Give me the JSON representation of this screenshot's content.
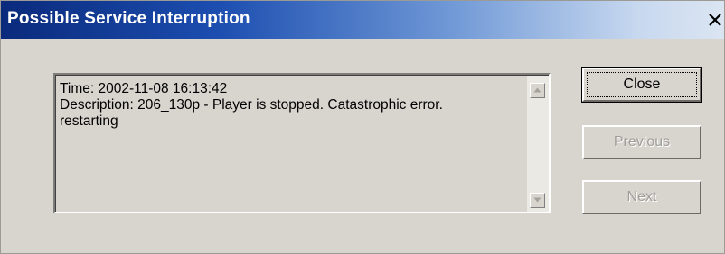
{
  "dialog": {
    "title": "Possible Service Interruption",
    "close_icon": "close-icon"
  },
  "message": {
    "lines": [
      "Time: 2002-11-08 16:13:42",
      "Description: 206_130p - Player is stopped. Catastrophic error.",
      "restarting"
    ]
  },
  "scrollbar": {
    "up_icon": "scroll-up-arrow-icon",
    "down_icon": "scroll-down-arrow-icon"
  },
  "buttons": {
    "close_label": "Close",
    "previous_label": "Previous",
    "next_label": "Next"
  },
  "colors": {
    "window_bg": "#d8d5cf",
    "titlebar_start": "#0a2a7c",
    "titlebar_end": "#dbe5f2",
    "title_text": "#ffffff",
    "disabled_text": "#a09e9a"
  }
}
